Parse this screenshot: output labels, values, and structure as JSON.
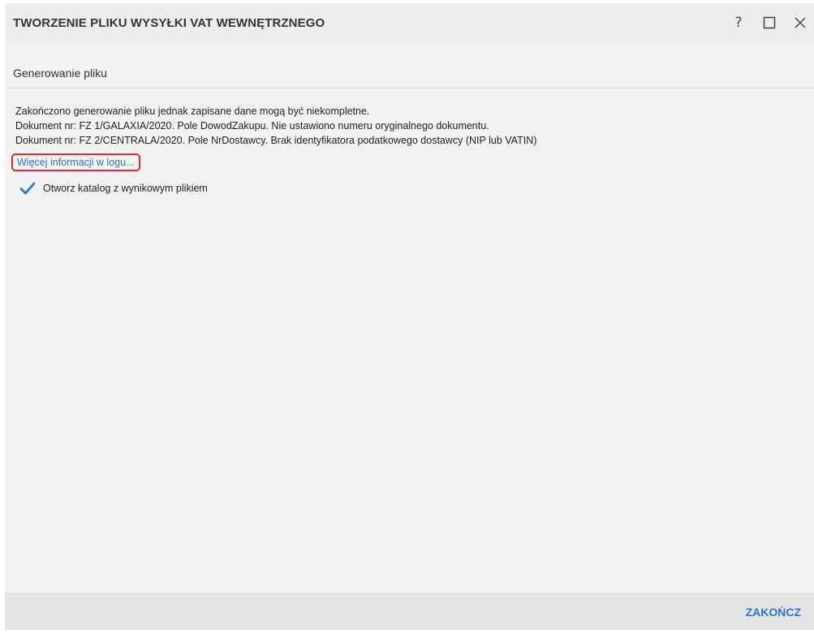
{
  "window": {
    "title": "TWORZENIE PLIKU WYSYŁKI VAT WEWNĘTRZNEGO",
    "title_buttons": [
      {
        "icon": "help-icon",
        "glyph": "?"
      },
      {
        "icon": "maximize-icon"
      },
      {
        "icon": "close-icon"
      }
    ]
  },
  "section": {
    "title": "Generowanie pliku"
  },
  "messages": [
    "Zakończono generowanie pliku jednak zapisane dane mogą być niekompletne.",
    "Dokument nr: FZ 1/GALAXIA/2020. Pole DowodZakupu. Nie ustawiono numeru oryginalnego dokumentu.",
    "Dokument nr: FZ 2/CENTRALA/2020. Pole NrDostawcy. Brak identyfikatora podatkowego dostawcy (NIP lub VATIN)"
  ],
  "log_link": {
    "label": "Więcej informacji w logu..."
  },
  "open_folder_checkbox": {
    "label": "Otworz katalog z wynikowym plikiem",
    "checked": true
  },
  "footer": {
    "finish_label": "ZAKOŃCZ"
  },
  "colors": {
    "accent": "#2a77c6",
    "highlight_border": "#e0282b",
    "window_background": "#f2f2f2",
    "footer_background": "#e4e4e4"
  }
}
